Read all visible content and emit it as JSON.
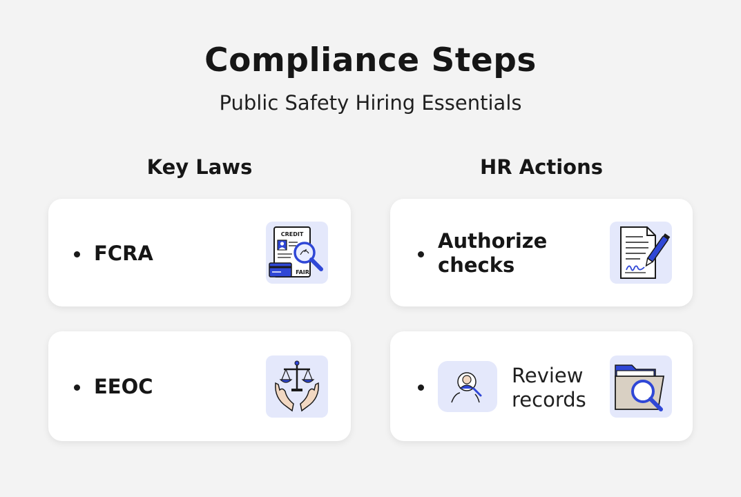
{
  "header": {
    "title": "Compliance Steps",
    "subtitle": "Public Safety Hiring Essentials"
  },
  "columns": {
    "left": {
      "heading": "Key Laws",
      "items": [
        {
          "label": "FCRA",
          "icon": "credit-report-magnifier-icon",
          "icon_texts": [
            "CREDIT",
            "FAIR"
          ]
        },
        {
          "label": "EEOC",
          "icon": "scales-of-justice-hands-icon"
        }
      ]
    },
    "right": {
      "heading": "HR Actions",
      "items": [
        {
          "label_line1": "Authorize",
          "label_line2": "checks",
          "icon": "signed-document-pen-icon"
        },
        {
          "label_line1": "Review",
          "label_line2": "records",
          "icon": "folder-magnifier-icon",
          "inline_icon": "person-search-icon"
        }
      ]
    }
  },
  "colors": {
    "background": "#f3f3f3",
    "card": "#ffffff",
    "icon_tile": "#e4e8fb",
    "accent_blue": "#2f47d6",
    "text": "#161616"
  }
}
